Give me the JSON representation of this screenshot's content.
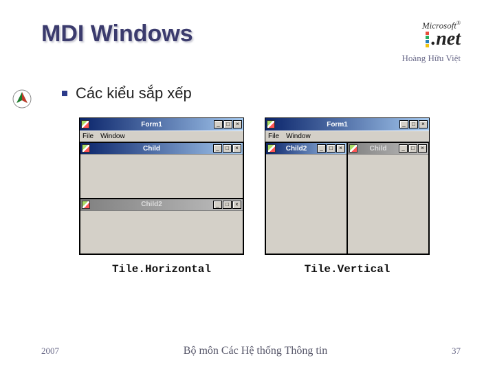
{
  "title": "MDI Windows",
  "logo": {
    "brand": "Microsoft",
    "product": ".net"
  },
  "author": "Hoàng Hữu Việt",
  "bullet": "Các kiểu sắp xếp",
  "example_h": {
    "form_title": "Form1",
    "menu": {
      "file": "File",
      "window": "Window"
    },
    "child1_title": "Child",
    "child2_title": "Child2",
    "caption": "Tile.Horizontal"
  },
  "example_v": {
    "form_title": "Form1",
    "menu": {
      "file": "File",
      "window": "Window"
    },
    "child1_title": "Child2",
    "child2_title": "Child",
    "caption": "Tile.Vertical"
  },
  "footer": {
    "year": "2007",
    "dept": "Bộ môn Các Hệ thống Thông tin",
    "page": "37"
  }
}
